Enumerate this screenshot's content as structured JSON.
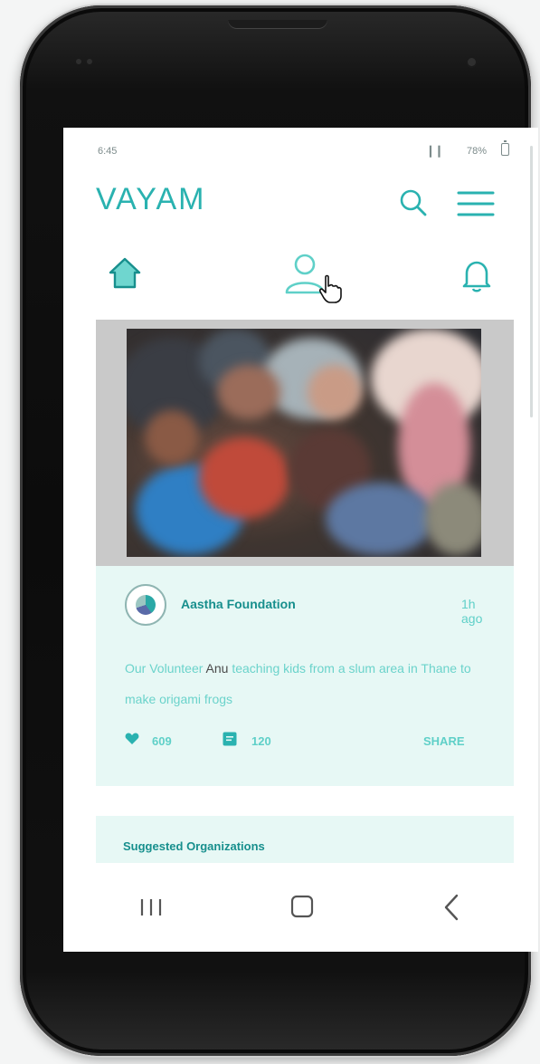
{
  "status_bar": {
    "time": "6:45",
    "signal": "▎▎",
    "battery": "78%"
  },
  "app": {
    "logo": "VAYAM"
  },
  "icons": {
    "search": "search-icon",
    "menu": "menu-icon",
    "home": "home-icon",
    "profile": "person-icon",
    "notifications": "bell-icon",
    "like": "heart-icon",
    "comment": "comment-icon"
  },
  "post": {
    "org_name": "Aastha Foundation",
    "time_ago": "1h ago",
    "text_before": "Our Volunteer ",
    "text_name": "Anu",
    "text_after": " teaching kids from a slum area in Thane to make origami frogs",
    "likes": "609",
    "comments": "120",
    "share": "SHARE"
  },
  "suggested": {
    "title": "Suggested Organizations"
  },
  "colors": {
    "accent": "#2ab2b0",
    "card_bg": "#e7f8f5",
    "dark_text": "#178f8d"
  }
}
